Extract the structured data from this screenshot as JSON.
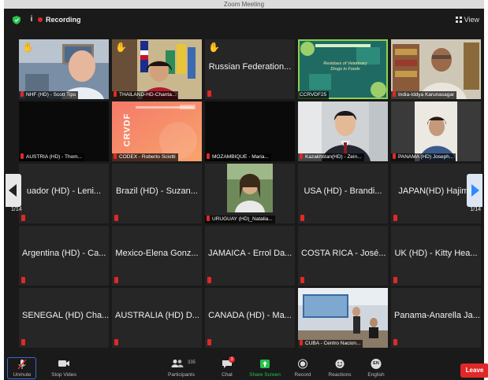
{
  "window": {
    "title": "Zoom Meeting"
  },
  "topbar": {
    "recording_label": "Recording",
    "view_label": "View"
  },
  "pagination": {
    "left": "1/14",
    "right": "1/14"
  },
  "tiles": [
    {
      "id": "nhf",
      "video_label": "NHF (HD) - Scott Tips",
      "hand": true
    },
    {
      "id": "thailand",
      "video_label": "THAILAND-HD-Chanta...",
      "hand": true
    },
    {
      "id": "russia",
      "name": "Russian Federation...",
      "hand": true
    },
    {
      "id": "ccrvdf25",
      "video_label": "CCRVDF25"
    },
    {
      "id": "india",
      "video_label": "India-Iddya Karunasagar"
    },
    {
      "id": "austria",
      "video_label": "AUSTRIA (HD) - Thom..."
    },
    {
      "id": "codex",
      "video_label": "CODEX - Roberto Sciotti"
    },
    {
      "id": "mozambique",
      "video_label": "MOZAMBIQUE - Maria..."
    },
    {
      "id": "kazakhstan",
      "video_label": "Kazakhstan(HD) - Zein..."
    },
    {
      "id": "panama-hd",
      "video_label": "PANAMA (HD) Joseph..."
    },
    {
      "id": "ecuador",
      "name": "uador (HD) - Leni..."
    },
    {
      "id": "brazil",
      "name": "Brazil (HD) - Suzan..."
    },
    {
      "id": "uruguay",
      "video_label": "URUGUAY (HD)_Natalia..."
    },
    {
      "id": "usa",
      "name": "USA (HD) - Brandi..."
    },
    {
      "id": "japan",
      "name": "JAPAN(HD) Hajime"
    },
    {
      "id": "argentina",
      "name": "Argentina (HD) - Ca..."
    },
    {
      "id": "mexico",
      "name": "Mexico-Elena Gonz..."
    },
    {
      "id": "jamaica",
      "name": "JAMAICA - Errol Da..."
    },
    {
      "id": "costarica",
      "name": "COSTA RICA - José..."
    },
    {
      "id": "uk",
      "name": "UK (HD) - Kitty Hea..."
    },
    {
      "id": "senegal",
      "name": "SENEGAL (HD) Cha..."
    },
    {
      "id": "australia",
      "name": "AUSTRALIA (HD) D..."
    },
    {
      "id": "canada",
      "name": "CANADA (HD) - Ma..."
    },
    {
      "id": "cuba",
      "video_label": "CUBA - Centro Nacion..."
    },
    {
      "id": "panama-anarella",
      "name": "Panama-Anarella Ja..."
    }
  ],
  "toolbar": {
    "unmute": "Unmute",
    "stop_video": "Stop Video",
    "participants": "Participants",
    "participants_count": "335",
    "chat": "Chat",
    "chat_badge": "3",
    "share_screen": "Share Screen",
    "record": "Record",
    "reactions": "Reactions",
    "english": "English",
    "english_icon_text": "EN",
    "leave": "Leave"
  },
  "colors": {
    "accent_green": "#8fd14f",
    "leave_red": "#e02828",
    "share_green": "#25c24a"
  },
  "ccrvdf_slide": {
    "title": "Residues of Veterinary Drugs in Foods"
  },
  "codex_slide": {
    "text": "CRVDF"
  }
}
